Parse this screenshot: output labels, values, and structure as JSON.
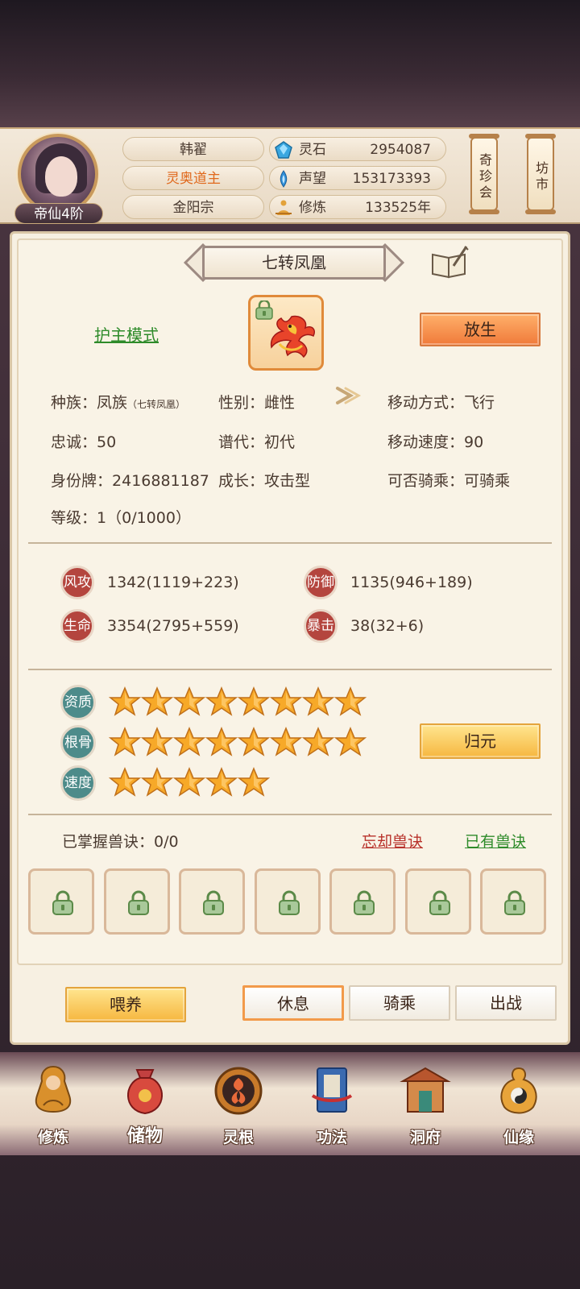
{
  "header": {
    "rank_badge": "帝仙4阶",
    "player_name": "韩翟",
    "title": "灵奥道主",
    "sect": "金阳宗",
    "resources": [
      {
        "icon": "spirit-stone-icon",
        "label": "灵石",
        "value": "2954087"
      },
      {
        "icon": "reputation-icon",
        "label": "声望",
        "value": "153173393"
      },
      {
        "icon": "cultivation-icon",
        "label": "修炼",
        "value": "133525年"
      }
    ],
    "side_buttons": [
      "奇珍会",
      "坊市"
    ]
  },
  "pet": {
    "name": "七转凤凰",
    "protect_mode": "护主模式",
    "release_button": "放生",
    "info": {
      "race_label": "种族：",
      "race": "凤族",
      "race_sub": "（七转凤凰）",
      "gender_label": "性别：",
      "gender": "雌性",
      "move_label": "移动方式：",
      "move": "飞行",
      "loyalty_label": "忠诚：",
      "loyalty": "50",
      "generation_label": "谱代：",
      "generation": "初代",
      "speed_label": "移动速度：",
      "speed": "90",
      "id_label": "身份牌：",
      "id": "2416881187",
      "growth_label": "成长：",
      "growth": "攻击型",
      "ride_label": "可否骑乘：",
      "ride": "可骑乘",
      "level_label": "等级：",
      "level": "1（0/1000）"
    },
    "stats": [
      {
        "badge": "风攻",
        "value": "1342(1119+223)"
      },
      {
        "badge": "防御",
        "value": "1135(946+189)"
      },
      {
        "badge": "生命",
        "value": "3354(2795+559)"
      },
      {
        "badge": "暴击",
        "value": "38(32+6)"
      }
    ],
    "attributes": [
      {
        "badge": "资质",
        "stars": 8
      },
      {
        "badge": "根骨",
        "stars": 8
      },
      {
        "badge": "速度",
        "stars": 5
      }
    ],
    "reset_button": "归元",
    "skills": {
      "mastered_label": "已掌握兽诀：0/0",
      "forget_link": "忘却兽诀",
      "owned_link": "已有兽诀",
      "slots": 7
    },
    "actions": {
      "feed": "喂养",
      "rest": "休息",
      "ride": "骑乘",
      "battle": "出战"
    }
  },
  "bottom_nav": [
    {
      "label": "修炼",
      "icon": "cultivate-icon"
    },
    {
      "label": "储物",
      "icon": "storage-bag-icon"
    },
    {
      "label": "灵根",
      "icon": "spirit-root-icon"
    },
    {
      "label": "功法",
      "icon": "technique-book-icon"
    },
    {
      "label": "洞府",
      "icon": "cave-dwelling-icon"
    },
    {
      "label": "仙缘",
      "icon": "immortal-fate-icon"
    }
  ],
  "colors": {
    "accent_orange": "#f07a3a",
    "accent_gold": "#f6b740",
    "link_green": "#2e8b2a",
    "link_red": "#b8312a",
    "stat_badge": "#b4453e",
    "attr_badge": "#4d8b8a"
  }
}
